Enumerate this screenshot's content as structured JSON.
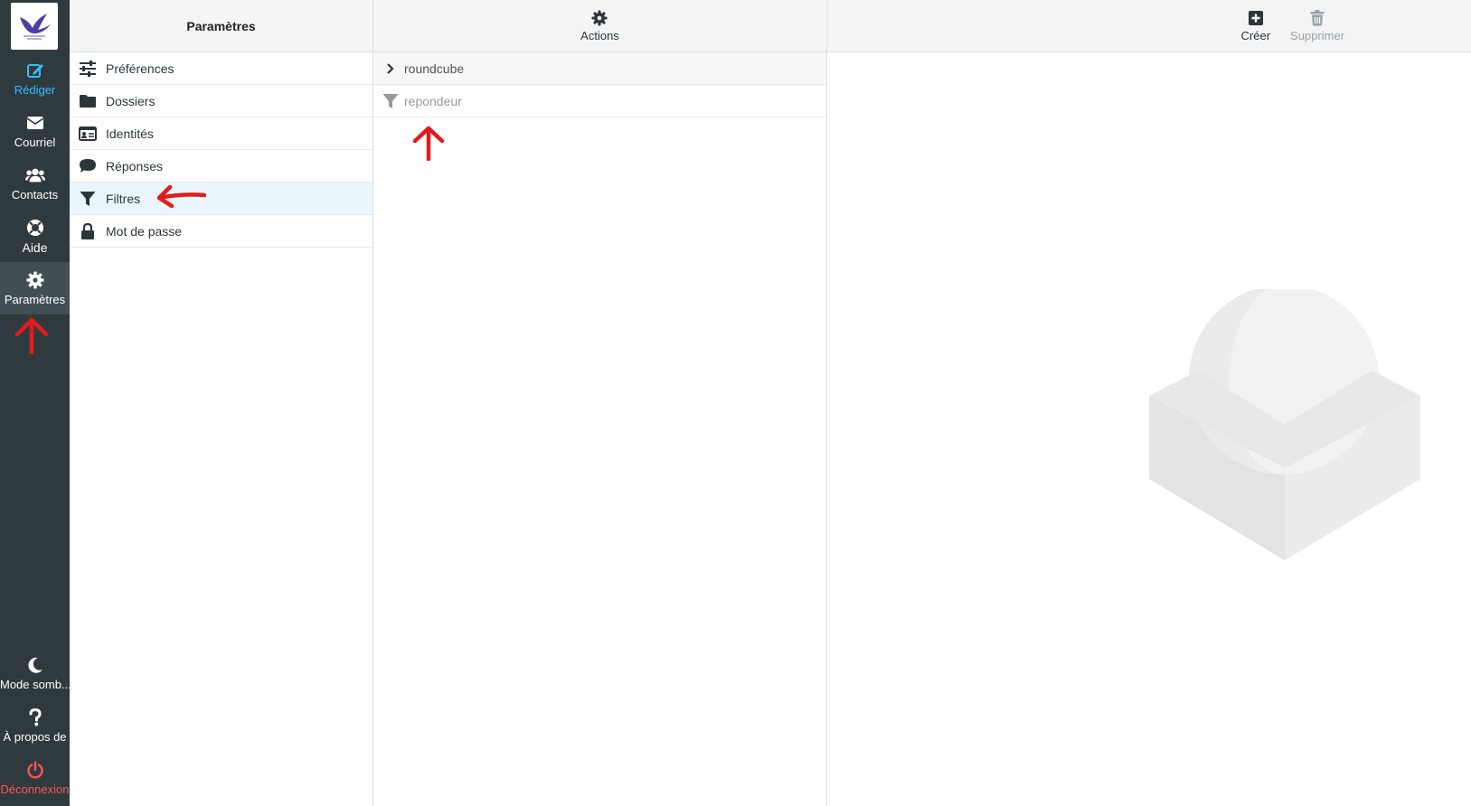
{
  "nav": {
    "compose": "Rédiger",
    "mail": "Courriel",
    "contacts": "Contacts",
    "help": "Aide",
    "settings": "Paramètres",
    "dark_mode": "Mode somb...",
    "about": "À propos de",
    "logout": "Déconnexion"
  },
  "settings_panel": {
    "title": "Paramètres",
    "items": [
      {
        "label": "Préférences",
        "icon": "sliders-icon"
      },
      {
        "label": "Dossiers",
        "icon": "folder-icon"
      },
      {
        "label": "Identités",
        "icon": "id-card-icon"
      },
      {
        "label": "Réponses",
        "icon": "comment-icon"
      },
      {
        "label": "Filtres",
        "icon": "filter-icon"
      },
      {
        "label": "Mot de passe",
        "icon": "lock-icon"
      }
    ]
  },
  "filters_panel": {
    "actions_label": "Actions",
    "filter_set": "roundcube",
    "filters": [
      {
        "label": "repondeur",
        "icon": "filter-icon"
      }
    ]
  },
  "content_toolbar": {
    "create": "Créer",
    "delete": "Supprimer"
  },
  "colors": {
    "rail_bg": "#2f3a3f",
    "accent": "#37beff",
    "logout": "#ff5552",
    "annotation": "#e31b1b"
  }
}
